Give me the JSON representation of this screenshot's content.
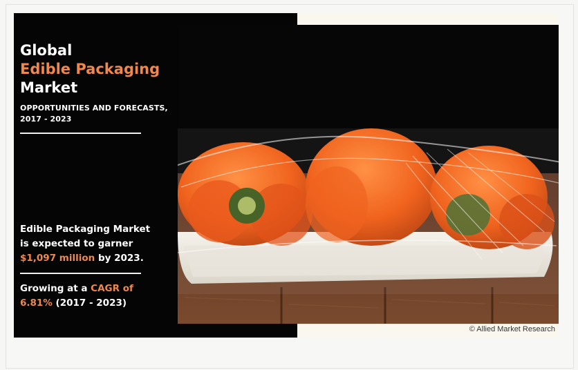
{
  "infographic": {
    "title_line1": "Global",
    "title_line2": "Edible Packaging",
    "title_line3": "Market",
    "subtitle_line1": "OPPORTUNITIES AND FORECASTS,",
    "subtitle_line2": "2017 - 2023",
    "stat1_line1": "Edible Packaging Market",
    "stat1_line2": "is expected to garner",
    "stat1_value": "$1,097 million",
    "stat1_suffix": " by 2023.",
    "stat2_prefix": "Growing at a ",
    "stat2_cagr_label": "CAGR of",
    "stat2_value": "6.81%",
    "stat2_suffix": " (2017 - 2023)",
    "copyright": "© Allied Market Research"
  },
  "image": {
    "subject": "orange-bell-peppers-in-plastic-wrapped-tray"
  },
  "colors": {
    "accent": "#f0874c",
    "panel": "#050505",
    "text": "#ffffff"
  }
}
